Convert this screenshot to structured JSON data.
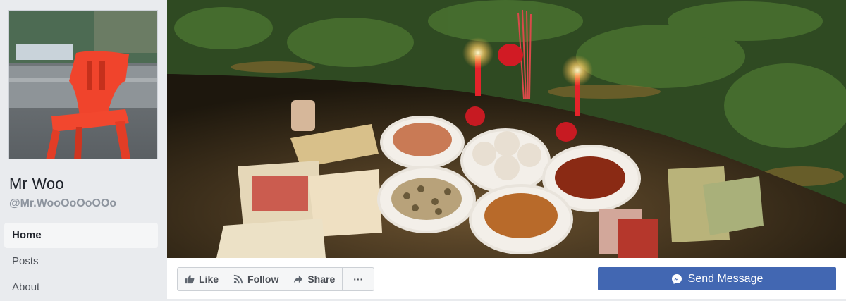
{
  "profile": {
    "name": "Mr Woo",
    "handle": "@Mr.WooOoOoOOo"
  },
  "sidebar": {
    "items": [
      {
        "label": "Home",
        "active": true
      },
      {
        "label": "Posts",
        "active": false
      },
      {
        "label": "About",
        "active": false
      }
    ]
  },
  "actions": {
    "like_label": "Like",
    "follow_label": "Follow",
    "share_label": "Share",
    "more_label": "···",
    "send_message_label": "Send Message"
  },
  "colors": {
    "primary_button": "#4267b2",
    "page_background": "#e9ebee",
    "chair_red": "#f0442c"
  },
  "icons": {
    "like": "thumbs-up-icon",
    "follow": "rss-icon",
    "share": "share-arrow-icon",
    "more": "more-horizontal-icon",
    "send": "messenger-icon"
  }
}
